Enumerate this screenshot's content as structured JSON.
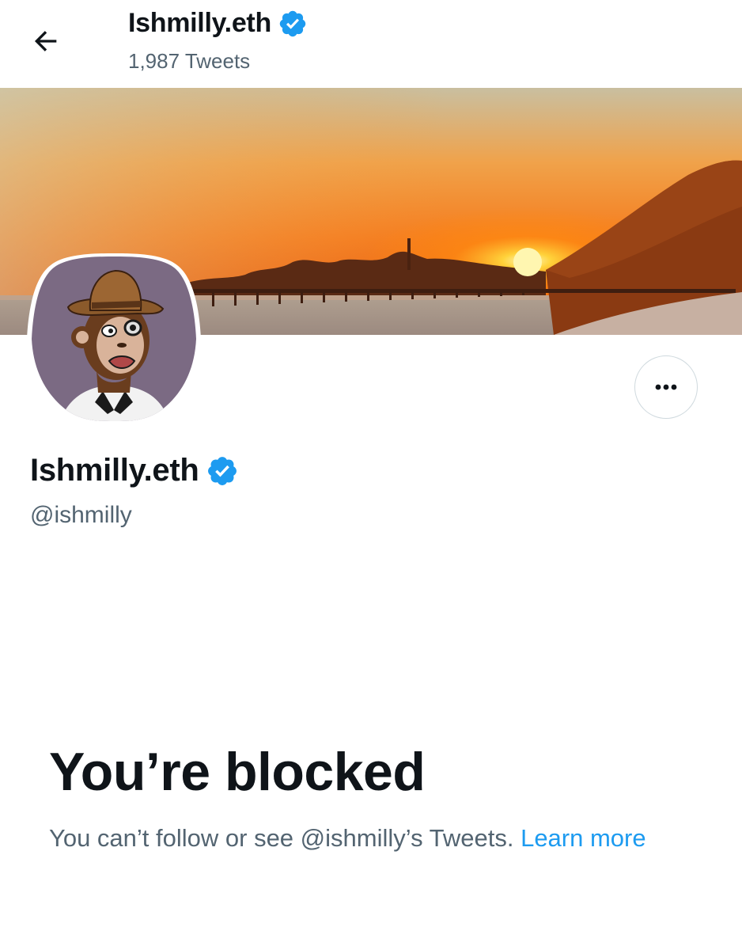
{
  "header": {
    "name": "Ishmilly.eth",
    "tweet_count": "1,987 Tweets"
  },
  "profile": {
    "name": "Ishmilly.eth",
    "handle": "@ishmilly",
    "verified": true
  },
  "blocked": {
    "title": "You’re blocked",
    "message": "You can’t follow or see @ishmilly’s Tweets.",
    "link_label": "Learn more"
  },
  "icons": {
    "back": "arrow-left-icon",
    "verified": "verified-badge-icon",
    "more": "more-horizontal-icon"
  },
  "colors": {
    "accent": "#1d9bf0",
    "secondary_text": "#536471",
    "primary_text": "#0f1419"
  }
}
